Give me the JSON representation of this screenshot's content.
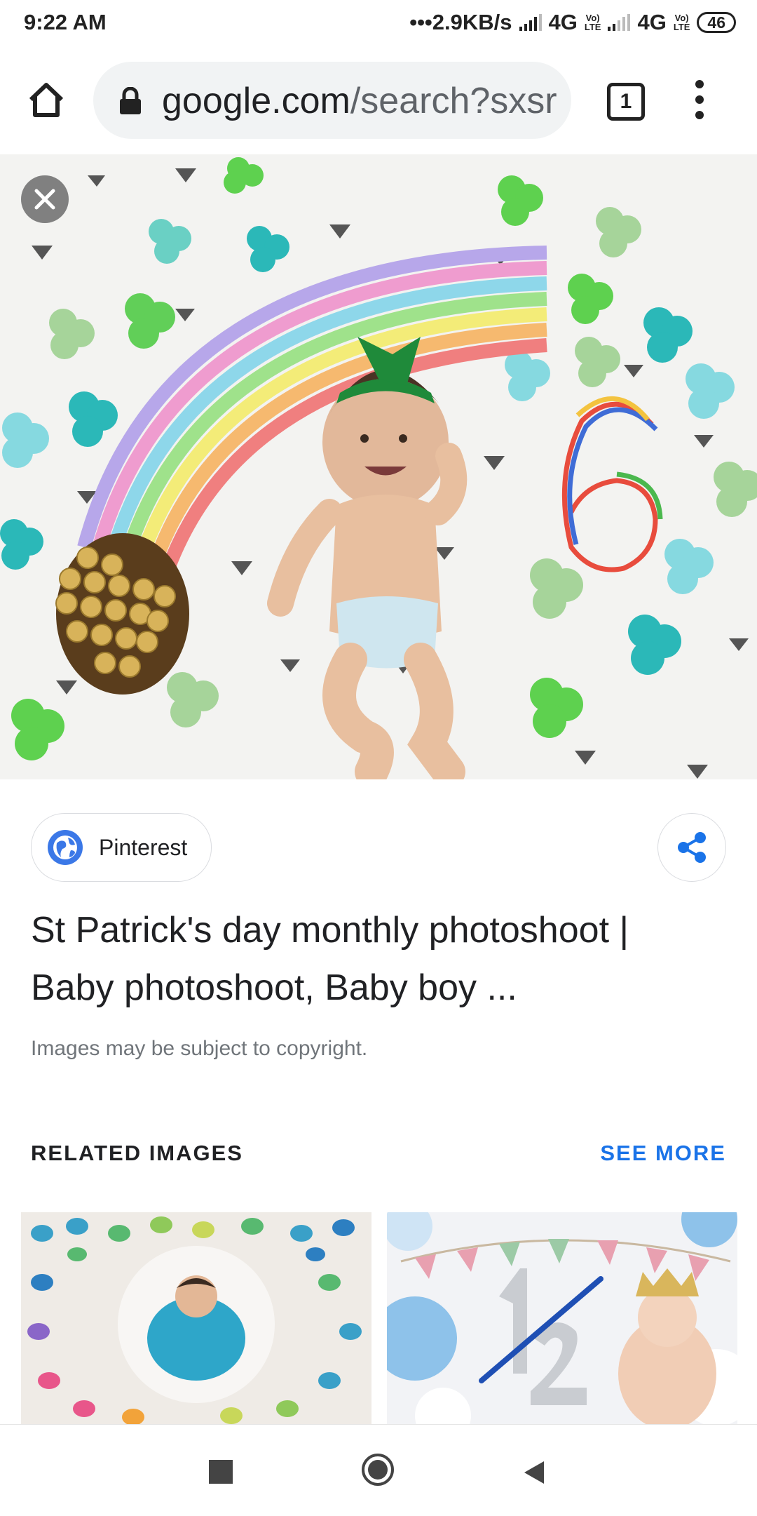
{
  "status_bar": {
    "time": "9:22 AM",
    "net_speed": "•••2.9KB/s",
    "network1": "4G",
    "network2": "4G",
    "volte_label_top": "Vo)",
    "volte_label_bottom": "LTE",
    "battery": "46"
  },
  "browser": {
    "url_host": "google.com",
    "url_path": "/search?sxsr",
    "tab_count": "1"
  },
  "result": {
    "source": "Pinterest",
    "title": "St Patrick's day monthly photoshoot | Baby photoshoot, Baby boy ...",
    "copyright_note": "Images may be subject to copyright."
  },
  "related": {
    "heading": "RELATED IMAGES",
    "see_more": "SEE MORE"
  },
  "icons": {
    "home": "home-icon",
    "lock": "lock-icon",
    "tabs": "tab-switcher-icon",
    "menu": "more-vert-icon",
    "close": "close-icon",
    "globe": "globe-icon",
    "share": "share-icon"
  },
  "colors": {
    "accent": "#1a73e8",
    "omnibox": "#f1f3f4",
    "title": "#202124",
    "muted": "#70757a"
  }
}
